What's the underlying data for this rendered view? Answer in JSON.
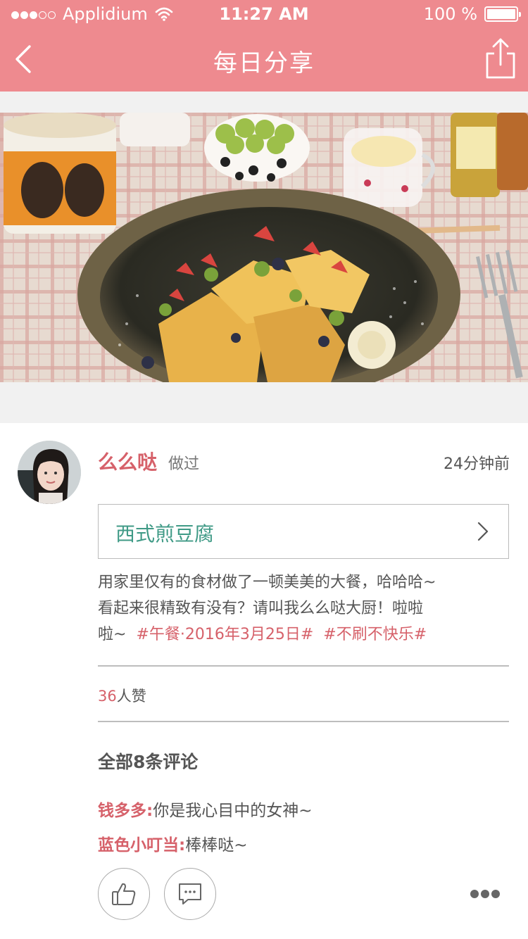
{
  "status_bar": {
    "carrier": "Applidium",
    "time": "11:27 AM",
    "battery": "100 %",
    "signal_bars_filled": 3,
    "signal_bars_total": 5
  },
  "nav": {
    "title": "每日分享",
    "back_icon": "chevron-left-icon",
    "share_icon": "share-icon"
  },
  "post": {
    "user_name": "么么哒",
    "action": "做过",
    "time": "24分钟前",
    "recipe": "西式煎豆腐",
    "text_line1": "用家里仅有的食材做了一顿美美的大餐，哈哈哈~",
    "text_line2": "看起来很精致有没有？请叫我么么哒大厨！啦啦",
    "text_line3": "啦~",
    "tags": [
      "#午餐·2016年3月25日#",
      "#不刷不快乐#"
    ],
    "likes_count": "36",
    "likes_suffix": "人赞"
  },
  "comments": {
    "title": "全部8条评论",
    "items": [
      {
        "author": "钱多多:",
        "text": "你是我心目中的女神~"
      },
      {
        "author": "蓝色小叮当:",
        "text": "棒棒哒~"
      }
    ]
  },
  "actions": {
    "like_icon": "thumbs-up-icon",
    "comment_icon": "comment-icon",
    "more_icon": "more-icon"
  },
  "colors": {
    "accent": "#ee8a8f",
    "name_pink": "#d6616a",
    "recipe_green": "#3f9a86"
  }
}
